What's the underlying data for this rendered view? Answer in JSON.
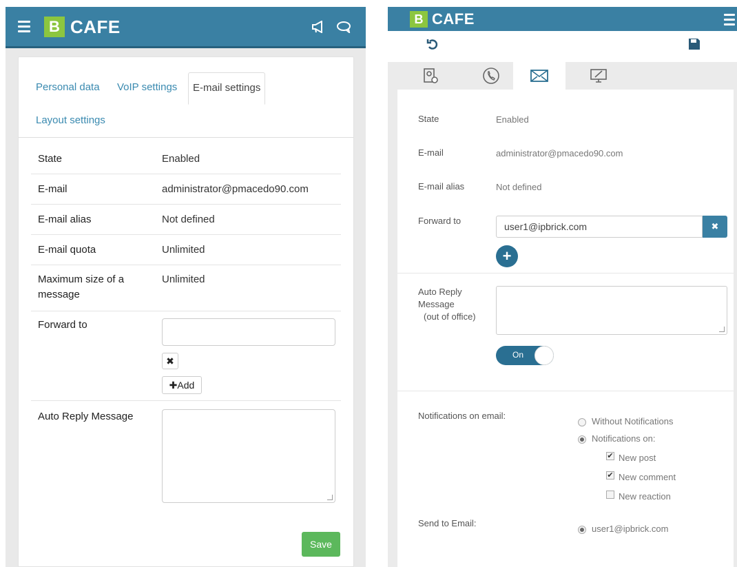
{
  "left": {
    "brand": {
      "logo_letter": "B",
      "name": "CAFE"
    },
    "tabs": [
      "Personal data",
      "VoIP settings",
      "E-mail settings",
      "Layout settings"
    ],
    "rows": [
      {
        "label": "State",
        "value": "Enabled"
      },
      {
        "label": "E-mail",
        "value": "administrator@pmacedo90.com"
      },
      {
        "label": "E-mail alias",
        "value": "Not defined"
      },
      {
        "label": "E-mail quota",
        "value": "Unlimited"
      },
      {
        "label": "Maximum size of a message",
        "value": "Unlimited"
      }
    ],
    "forward_label": "Forward to",
    "forward_value": "",
    "add_label": "Add",
    "auto_reply_label": "Auto Reply Message",
    "save_label": "Save"
  },
  "right": {
    "brand": {
      "logo_letter": "B",
      "name": "CAFE"
    },
    "rows": [
      {
        "label": "State",
        "value": "Enabled"
      },
      {
        "label": "E-mail",
        "value": "administrator@pmacedo90.com"
      },
      {
        "label": "E-mail alias",
        "value": "Not defined"
      }
    ],
    "forward_label": "Forward to",
    "forward_value": "user1@ipbrick.com",
    "auto_reply_label_1": "Auto Reply",
    "auto_reply_label_2": "Message",
    "auto_reply_label_3": "(out of office)",
    "toggle_label": "On",
    "notifications_label": "Notifications on email:",
    "notif_options": [
      "Without Notifications",
      "Notifications on:"
    ],
    "notif_checks": [
      "New post",
      "New comment",
      "New reaction"
    ],
    "send_to_label": "Send to Email:",
    "send_to_value": "user1@ipbrick.com"
  },
  "colors": {
    "header": "#3a80a3",
    "logo": "#8cc63f",
    "save": "#5cb85c",
    "accent_dark": "#2a6f92"
  }
}
